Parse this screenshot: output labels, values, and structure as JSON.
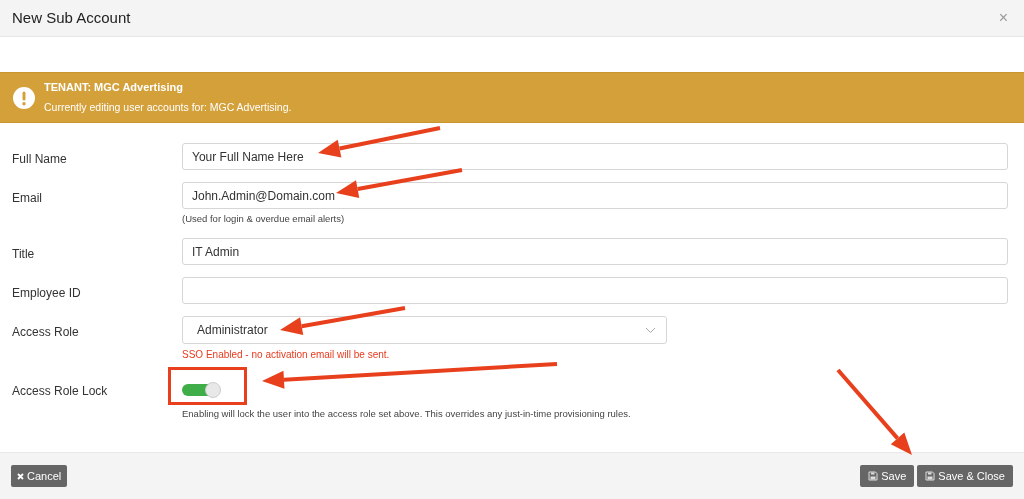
{
  "dialog": {
    "title": "New Sub Account",
    "close": "×"
  },
  "banner": {
    "title": "TENANT: MGC Advertising",
    "message": "Currently editing user accounts for: MGC Advertising."
  },
  "fields": [
    {
      "kind": "text",
      "label": "Full Name",
      "value": "Your Full Name Here"
    },
    {
      "kind": "text",
      "label": "Email",
      "value": "John.Admin@Domain.com",
      "hint": "(Used for login & overdue email alerts)"
    },
    {
      "kind": "text",
      "label": "Title",
      "value": "IT Admin"
    },
    {
      "kind": "text",
      "label": "Employee ID"
    },
    {
      "kind": "select",
      "label": "Access Role",
      "value": "Administrator",
      "warning": "SSO Enabled - no activation email will be sent."
    },
    {
      "kind": "toggle",
      "label": "Access Role Lock",
      "on": true,
      "hint": "Enabling will lock the user into the access role set above. This overrides any just-in-time provisioning rules."
    }
  ],
  "footer": {
    "cancel": "Cancel",
    "save": "Save",
    "save_close": "Save & Close"
  }
}
